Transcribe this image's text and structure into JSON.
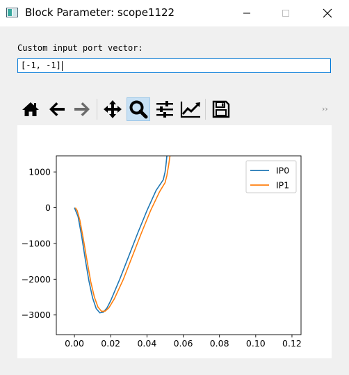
{
  "window": {
    "title": "Block Parameter: scope1122"
  },
  "form": {
    "label": "Custom input port vector:",
    "value": "[-1, -1]"
  },
  "toolbar": {
    "buttons": [
      {
        "name": "home",
        "icon": "home-icon"
      },
      {
        "name": "back",
        "icon": "arrow-left-icon"
      },
      {
        "name": "forward",
        "icon": "arrow-right-icon"
      },
      {
        "name": "pan",
        "icon": "move-icon"
      },
      {
        "name": "zoom",
        "icon": "magnifier-icon",
        "active": true
      },
      {
        "name": "subplots",
        "icon": "sliders-icon"
      },
      {
        "name": "customize",
        "icon": "line-chart-icon"
      },
      {
        "name": "save",
        "icon": "floppy-disk-icon"
      }
    ],
    "overflow_label": "››"
  },
  "chart_data": {
    "type": "line",
    "xlim": [
      -0.01,
      0.125
    ],
    "ylim": [
      -3550,
      1450
    ],
    "xticks": [
      "0.00",
      "0.02",
      "0.04",
      "0.06",
      "0.08",
      "0.10",
      "0.12"
    ],
    "yticks": [
      "1000",
      "0",
      "−1000",
      "−2000",
      "−3000"
    ],
    "legend_position": "top-right",
    "series": [
      {
        "name": "IP0",
        "color": "#1f77b4",
        "points": [
          [
            0,
            0
          ],
          [
            0.002,
            -250
          ],
          [
            0.004,
            -800
          ],
          [
            0.006,
            -1450
          ],
          [
            0.008,
            -2050
          ],
          [
            0.01,
            -2520
          ],
          [
            0.012,
            -2820
          ],
          [
            0.014,
            -2940
          ],
          [
            0.016,
            -2920
          ],
          [
            0.018,
            -2800
          ],
          [
            0.02,
            -2600
          ],
          [
            0.025,
            -2000
          ],
          [
            0.03,
            -1350
          ],
          [
            0.035,
            -700
          ],
          [
            0.04,
            -80
          ],
          [
            0.045,
            480
          ],
          [
            0.049,
            780
          ],
          [
            0.05,
            1000
          ],
          [
            0.0505,
            1200
          ],
          [
            0.051,
            1450
          ]
        ]
      },
      {
        "name": "IP1",
        "color": "#ff7f0e",
        "points": [
          [
            0.0005,
            0
          ],
          [
            0.0015,
            -80
          ],
          [
            0.003,
            -350
          ],
          [
            0.005,
            -900
          ],
          [
            0.007,
            -1500
          ],
          [
            0.009,
            -2070
          ],
          [
            0.011,
            -2500
          ],
          [
            0.013,
            -2780
          ],
          [
            0.015,
            -2900
          ],
          [
            0.017,
            -2890
          ],
          [
            0.019,
            -2800
          ],
          [
            0.022,
            -2550
          ],
          [
            0.027,
            -2000
          ],
          [
            0.032,
            -1350
          ],
          [
            0.037,
            -700
          ],
          [
            0.042,
            -80
          ],
          [
            0.047,
            450
          ],
          [
            0.05,
            700
          ],
          [
            0.051,
            900
          ],
          [
            0.052,
            1200
          ],
          [
            0.0527,
            1450
          ]
        ]
      }
    ]
  }
}
